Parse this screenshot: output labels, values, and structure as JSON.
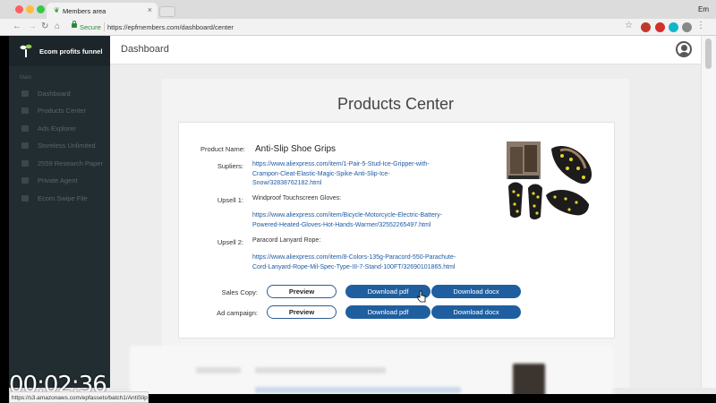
{
  "browser": {
    "tab_title": "Members area",
    "secure_label": "Secure",
    "url": "https://epfmembers.com/dashboard/center",
    "corner_label": "Em"
  },
  "sidebar": {
    "brand": "Ecom profits funnel",
    "menu_heading": "Main",
    "items": [
      {
        "label": "Dashboard"
      },
      {
        "label": "Products Center"
      },
      {
        "label": "Ads Explorer"
      },
      {
        "label": "Storeless Unlimited"
      },
      {
        "label": "2559 Research Paper"
      },
      {
        "label": "Private Agent"
      },
      {
        "label": "Ecom Swipe File"
      }
    ]
  },
  "header": {
    "title": "Dashboard"
  },
  "main": {
    "heading": "Products Center",
    "product": {
      "name_label": "Product Name:",
      "name": "Anti-Slip Shoe Grips",
      "suppliers_label": "Supliers:",
      "supplier_link": [
        "https://www.aliexpress.com/item/1-Pair-5-Stud-Ice-Gripper-with-",
        "Crampon-Cleat-Elastic-Magic-Spike-Anti-Slip-Ice-",
        "Snow/32838762182.html"
      ],
      "upsell1_label": "Upsell 1:",
      "upsell1_name": "Windproof Touchscreen Gloves:",
      "upsell1_link": [
        "https://www.aliexpress.com/item/Bicycle-Motorcycle-Electric-Battery-",
        "Powered-Heated-Gloves-Hot-Hands-Warmer/32552265497.html"
      ],
      "upsell2_label": "Upsell 2:",
      "upsell2_name": "Paracord Lanyard Rope:",
      "upsell2_link": [
        "https://www.aliexpress.com/item/8-Colors-135g-Paracord-550-Parachute-",
        "Cord-Lanyard-Rope-Mil-Spec-Type-III-7-Stand-100FT/32690101865.html"
      ]
    },
    "sales_copy": {
      "label": "Sales Copy:",
      "preview": "Preview",
      "pdf": "Download pdf",
      "docx": "Download docx"
    },
    "ad_campaign": {
      "label": "Ad campaign:",
      "preview": "Preview",
      "pdf": "Download pdf",
      "docx": "Download docx"
    }
  },
  "overlay": {
    "timer": "00:02:36",
    "status_url": "https://s3.amazonaws.com/epfassets/batch1/AntiSlip..."
  },
  "colors": {
    "sidebar_bg": "#222d32",
    "link": "#1f5aa0",
    "button_blue": "#1f5fa0"
  }
}
